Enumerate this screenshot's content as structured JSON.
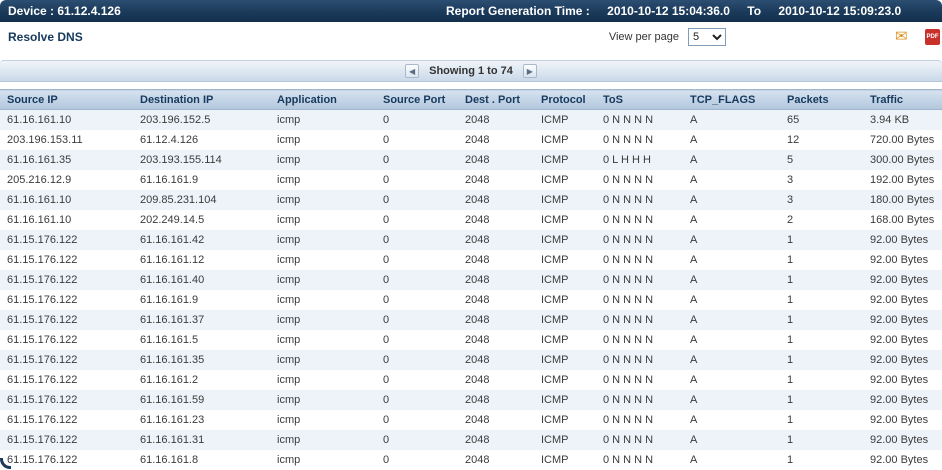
{
  "header": {
    "device": "Device : 61.12.4.126",
    "report_time_label": "Report Generation Time :",
    "from_time": "2010-10-12 15:04:36.0",
    "to_label": "To",
    "to_time": "2010-10-12 15:09:23.0"
  },
  "toolbar": {
    "resolve_dns": "Resolve DNS",
    "view_per_page_label": "View per page",
    "view_per_page_value": "5",
    "email_glyph": "✉",
    "pdf_glyph": "PDF"
  },
  "pagination": {
    "prev": "◀",
    "showing": "Showing 1 to 74",
    "next": "▶"
  },
  "table": {
    "columns": [
      "Source IP",
      "Destination IP",
      "Application",
      "Source Port",
      "Dest . Port",
      "Protocol",
      "ToS",
      "TCP_FLAGS",
      "Packets",
      "Traffic"
    ],
    "rows": [
      [
        "61.16.161.10",
        "203.196.152.5",
        "icmp",
        "0",
        "2048",
        "ICMP",
        "0 N N N N",
        "A",
        "65",
        "3.94 KB"
      ],
      [
        "203.196.153.11",
        "61.12.4.126",
        "icmp",
        "0",
        "2048",
        "ICMP",
        "0 N N N N",
        "A",
        "12",
        "720.00 Bytes"
      ],
      [
        "61.16.161.35",
        "203.193.155.114",
        "icmp",
        "0",
        "2048",
        "ICMP",
        "0 L H H H",
        "A",
        "5",
        "300.00 Bytes"
      ],
      [
        "205.216.12.9",
        "61.16.161.9",
        "icmp",
        "0",
        "2048",
        "ICMP",
        "0 N N N N",
        "A",
        "3",
        "192.00 Bytes"
      ],
      [
        "61.16.161.10",
        "209.85.231.104",
        "icmp",
        "0",
        "2048",
        "ICMP",
        "0 N N N N",
        "A",
        "3",
        "180.00 Bytes"
      ],
      [
        "61.16.161.10",
        "202.249.14.5",
        "icmp",
        "0",
        "2048",
        "ICMP",
        "0 N N N N",
        "A",
        "2",
        "168.00 Bytes"
      ],
      [
        "61.15.176.122",
        "61.16.161.42",
        "icmp",
        "0",
        "2048",
        "ICMP",
        "0 N N N N",
        "A",
        "1",
        "92.00 Bytes"
      ],
      [
        "61.15.176.122",
        "61.16.161.12",
        "icmp",
        "0",
        "2048",
        "ICMP",
        "0 N N N N",
        "A",
        "1",
        "92.00 Bytes"
      ],
      [
        "61.15.176.122",
        "61.16.161.40",
        "icmp",
        "0",
        "2048",
        "ICMP",
        "0 N N N N",
        "A",
        "1",
        "92.00 Bytes"
      ],
      [
        "61.15.176.122",
        "61.16.161.9",
        "icmp",
        "0",
        "2048",
        "ICMP",
        "0 N N N N",
        "A",
        "1",
        "92.00 Bytes"
      ],
      [
        "61.15.176.122",
        "61.16.161.37",
        "icmp",
        "0",
        "2048",
        "ICMP",
        "0 N N N N",
        "A",
        "1",
        "92.00 Bytes"
      ],
      [
        "61.15.176.122",
        "61.16.161.5",
        "icmp",
        "0",
        "2048",
        "ICMP",
        "0 N N N N",
        "A",
        "1",
        "92.00 Bytes"
      ],
      [
        "61.15.176.122",
        "61.16.161.35",
        "icmp",
        "0",
        "2048",
        "ICMP",
        "0 N N N N",
        "A",
        "1",
        "92.00 Bytes"
      ],
      [
        "61.15.176.122",
        "61.16.161.2",
        "icmp",
        "0",
        "2048",
        "ICMP",
        "0 N N N N",
        "A",
        "1",
        "92.00 Bytes"
      ],
      [
        "61.15.176.122",
        "61.16.161.59",
        "icmp",
        "0",
        "2048",
        "ICMP",
        "0 N N N N",
        "A",
        "1",
        "92.00 Bytes"
      ],
      [
        "61.15.176.122",
        "61.16.161.23",
        "icmp",
        "0",
        "2048",
        "ICMP",
        "0 N N N N",
        "A",
        "1",
        "92.00 Bytes"
      ],
      [
        "61.15.176.122",
        "61.16.161.31",
        "icmp",
        "0",
        "2048",
        "ICMP",
        "0 N N N N",
        "A",
        "1",
        "92.00 Bytes"
      ],
      [
        "61.15.176.122",
        "61.16.161.8",
        "icmp",
        "0",
        "2048",
        "ICMP",
        "0 N N N N",
        "A",
        "1",
        "92.00 Bytes"
      ]
    ]
  },
  "colors": {
    "topbar_navy": "#1b3a5a",
    "header_gradient_top": "#d7e2ef",
    "header_gradient_bottom": "#b2c7dc",
    "header_text": "#17395d",
    "row_alt": "#eef3f9",
    "mail_orange": "#dd9422",
    "pdf_red": "#c9302c"
  }
}
